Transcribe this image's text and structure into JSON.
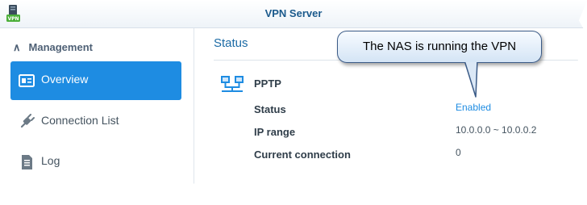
{
  "window": {
    "title": "VPN Server"
  },
  "sidebar": {
    "section": {
      "label": "Management"
    },
    "items": [
      {
        "label": "Overview",
        "active": true
      },
      {
        "label": "Connection List",
        "active": false
      },
      {
        "label": "Log",
        "active": false
      }
    ]
  },
  "main": {
    "status_title": "Status",
    "pptp": {
      "label": "PPTP",
      "rows": [
        {
          "label": "Status",
          "value": "Enabled"
        },
        {
          "label": "IP range",
          "value": "10.0.0.0 ~ 10.0.0.2"
        },
        {
          "label": "Current connection",
          "value": "0"
        }
      ]
    }
  },
  "callout": {
    "text": "The NAS is running the VPN"
  },
  "colors": {
    "accent": "#1e8ce2",
    "title": "#1b5a8c",
    "callout_border": "#3b5b87"
  }
}
